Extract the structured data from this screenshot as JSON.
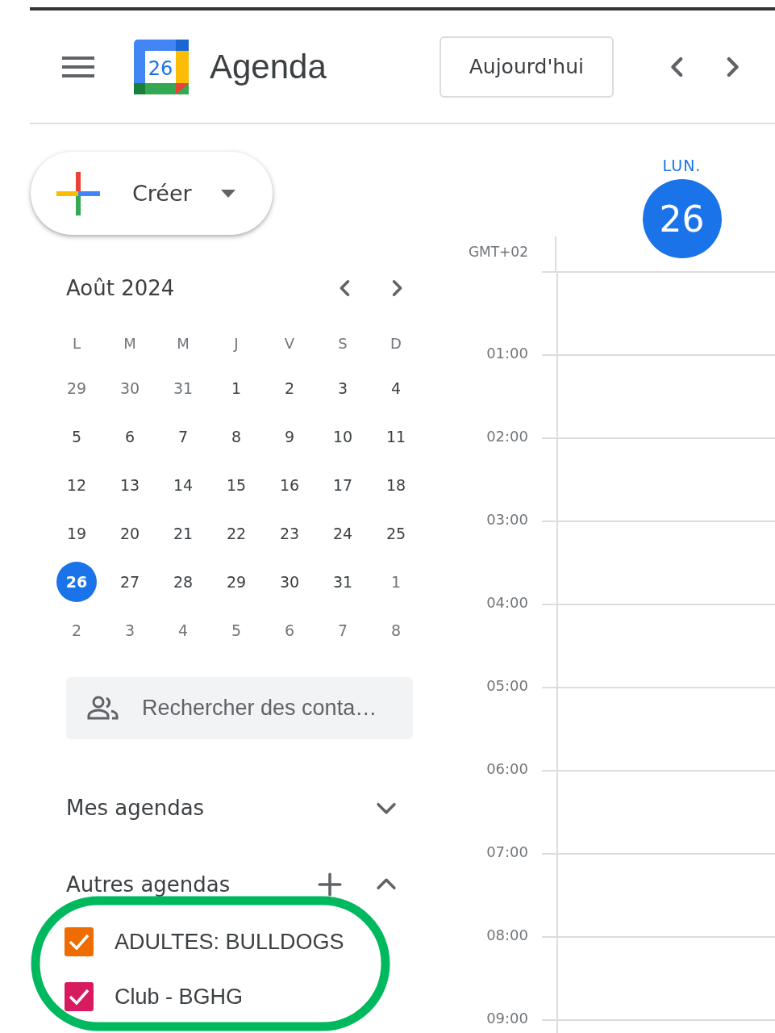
{
  "header": {
    "logo_day": "26",
    "app_title": "Agenda",
    "today_button": "Aujourd'hui"
  },
  "create_button": {
    "label": "Créer"
  },
  "mini_calendar": {
    "month": "Août 2024",
    "weekdays": [
      "L",
      "M",
      "M",
      "J",
      "V",
      "S",
      "D"
    ],
    "weeks": [
      [
        {
          "day": "29",
          "muted": true,
          "selected": false
        },
        {
          "day": "30",
          "muted": true,
          "selected": false
        },
        {
          "day": "31",
          "muted": true,
          "selected": false
        },
        {
          "day": "1",
          "muted": false,
          "selected": false
        },
        {
          "day": "2",
          "muted": false,
          "selected": false
        },
        {
          "day": "3",
          "muted": false,
          "selected": false
        },
        {
          "day": "4",
          "muted": false,
          "selected": false
        }
      ],
      [
        {
          "day": "5",
          "muted": false,
          "selected": false
        },
        {
          "day": "6",
          "muted": false,
          "selected": false
        },
        {
          "day": "7",
          "muted": false,
          "selected": false
        },
        {
          "day": "8",
          "muted": false,
          "selected": false
        },
        {
          "day": "9",
          "muted": false,
          "selected": false
        },
        {
          "day": "10",
          "muted": false,
          "selected": false
        },
        {
          "day": "11",
          "muted": false,
          "selected": false
        }
      ],
      [
        {
          "day": "12",
          "muted": false,
          "selected": false
        },
        {
          "day": "13",
          "muted": false,
          "selected": false
        },
        {
          "day": "14",
          "muted": false,
          "selected": false
        },
        {
          "day": "15",
          "muted": false,
          "selected": false
        },
        {
          "day": "16",
          "muted": false,
          "selected": false
        },
        {
          "day": "17",
          "muted": false,
          "selected": false
        },
        {
          "day": "18",
          "muted": false,
          "selected": false
        }
      ],
      [
        {
          "day": "19",
          "muted": false,
          "selected": false
        },
        {
          "day": "20",
          "muted": false,
          "selected": false
        },
        {
          "day": "21",
          "muted": false,
          "selected": false
        },
        {
          "day": "22",
          "muted": false,
          "selected": false
        },
        {
          "day": "23",
          "muted": false,
          "selected": false
        },
        {
          "day": "24",
          "muted": false,
          "selected": false
        },
        {
          "day": "25",
          "muted": false,
          "selected": false
        }
      ],
      [
        {
          "day": "26",
          "muted": false,
          "selected": true
        },
        {
          "day": "27",
          "muted": false,
          "selected": false
        },
        {
          "day": "28",
          "muted": false,
          "selected": false
        },
        {
          "day": "29",
          "muted": false,
          "selected": false
        },
        {
          "day": "30",
          "muted": false,
          "selected": false
        },
        {
          "day": "31",
          "muted": false,
          "selected": false
        },
        {
          "day": "1",
          "muted": true,
          "selected": false
        }
      ],
      [
        {
          "day": "2",
          "muted": true,
          "selected": false
        },
        {
          "day": "3",
          "muted": true,
          "selected": false
        },
        {
          "day": "4",
          "muted": true,
          "selected": false
        },
        {
          "day": "5",
          "muted": true,
          "selected": false
        },
        {
          "day": "6",
          "muted": true,
          "selected": false
        },
        {
          "day": "7",
          "muted": true,
          "selected": false
        },
        {
          "day": "8",
          "muted": true,
          "selected": false
        }
      ]
    ]
  },
  "contact_search": {
    "placeholder": "Rechercher des conta…"
  },
  "sections": [
    {
      "title": "Mes agendas",
      "expanded": false,
      "can_add": false
    },
    {
      "title": "Autres agendas",
      "expanded": true,
      "can_add": true
    }
  ],
  "other_calendars": [
    {
      "name": "ADULTES: BULLDOGS",
      "checked": true,
      "color": "#ef6c00"
    },
    {
      "name": "Club - BGHG",
      "checked": true,
      "color": "#d81b60"
    }
  ],
  "day_view": {
    "weekday": "LUN.",
    "date": "26",
    "today": true,
    "timezone": "GMT+02",
    "hours": [
      "01:00",
      "02:00",
      "03:00",
      "04:00",
      "05:00",
      "06:00",
      "07:00",
      "08:00",
      "09:00"
    ]
  }
}
